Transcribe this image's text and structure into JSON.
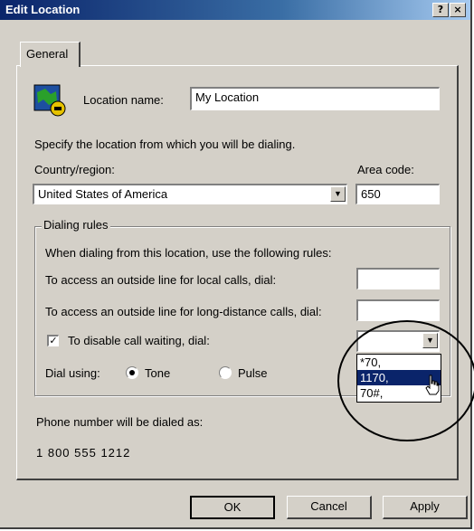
{
  "window": {
    "title": "Edit Location",
    "help_label": "?",
    "close_label": "×"
  },
  "tabs": [
    {
      "label": "General"
    }
  ],
  "location": {
    "label": "Location name:",
    "value": "My Location"
  },
  "instructions": "Specify the location from which you will be dialing.",
  "country": {
    "label": "Country/region:",
    "value": "United States of America"
  },
  "area_code": {
    "label": "Area code:",
    "value": "650"
  },
  "dialing_rules": {
    "group_label": "Dialing rules",
    "intro": "When dialing from this location, use the following rules:",
    "local_label": "To access an outside line for local calls, dial:",
    "local_value": "",
    "long_distance_label": "To access an outside line for long-distance calls, dial:",
    "long_distance_value": "",
    "call_waiting_label": "To disable call waiting, dial:",
    "call_waiting_checked": true,
    "call_waiting_options": [
      "*70,",
      "1170,",
      "70#,"
    ],
    "call_waiting_highlighted": "1170,",
    "dial_using_label": "Dial using:",
    "tone_label": "Tone",
    "pulse_label": "Pulse",
    "dial_mode": "Tone"
  },
  "phone": {
    "label": "Phone number will be dialed as:",
    "number": "1 800 555 1212"
  },
  "buttons": {
    "ok": "OK",
    "cancel": "Cancel",
    "apply": "Apply"
  },
  "colors": {
    "face": "#d4d0c8",
    "title_start": "#0a246a",
    "selection": "#0a246a"
  }
}
